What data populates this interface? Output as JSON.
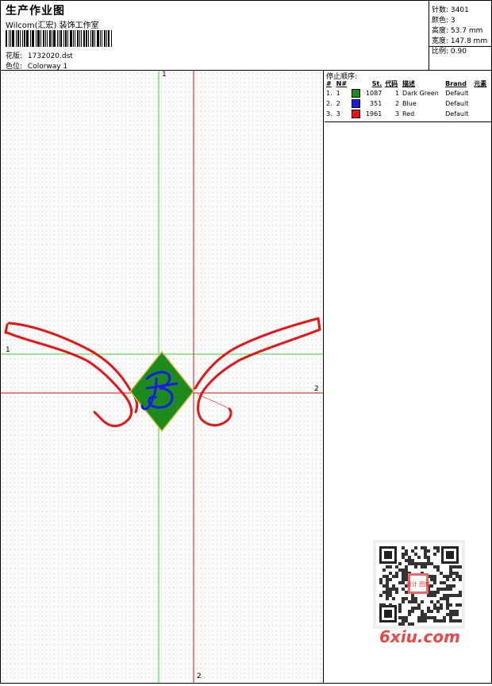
{
  "header": {
    "title": "生产作业图",
    "company": "Wilcom(汇宏) 装饰工作室",
    "design_label": "花版:",
    "design_value": "1732020.dst",
    "colorway_label": "色位:",
    "colorway_value": "Colorway 1"
  },
  "stats": {
    "stitches_label": "针数:",
    "stitches_value": "3401",
    "colors_label": "颜色:",
    "colors_value": "3",
    "height_label": "高度:",
    "height_value": "53.7 mm",
    "width_label": "宽度:",
    "width_value": "147.8 mm",
    "scale_label": "比例:",
    "scale_value": "0.90"
  },
  "stop_sequence": {
    "title": "停止顺序:",
    "columns": [
      "#",
      "N#",
      "St.",
      "代码",
      "描述",
      "Brand",
      "元素"
    ],
    "rows": [
      {
        "num": "1.",
        "n": "1",
        "stitches": "1087",
        "code": "1",
        "desc": "Dark Green",
        "brand": "Default",
        "color": "#1d8a1d"
      },
      {
        "num": "2.",
        "n": "2",
        "stitches": "351",
        "code": "2",
        "desc": "Blue",
        "brand": "Default",
        "color": "#1a1aeb"
      },
      {
        "num": "3.",
        "n": "3",
        "stitches": "1961",
        "code": "3",
        "desc": "Red",
        "brand": "Default",
        "color": "#ee1111"
      }
    ]
  },
  "axes": {
    "top_label": "1",
    "left_label": "1",
    "right_label": "2",
    "bottom_label": "2",
    "green": "#2ee52e",
    "red": "#e01010"
  },
  "watermark": {
    "text": "6xiu.com",
    "stamp": "设计 图库"
  }
}
